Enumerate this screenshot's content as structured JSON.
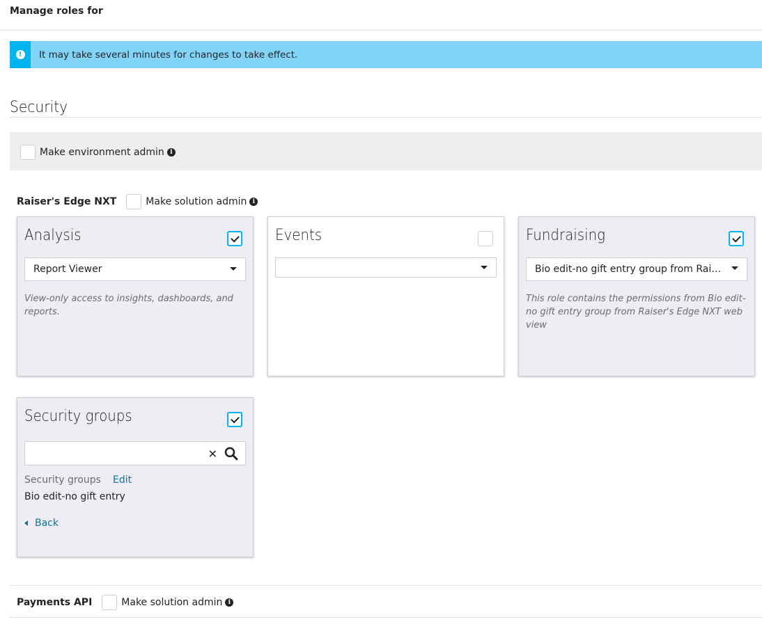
{
  "header": {
    "title": "Manage roles for"
  },
  "alert": {
    "icon": "exclamation-icon",
    "text": "It may take several minutes for changes to take effect.",
    "color": "#81d3f7",
    "accent": "#00b4f1"
  },
  "security": {
    "title": "Security",
    "environment_admin": {
      "label": "Make environment admin",
      "checked": false
    }
  },
  "raisers_edge": {
    "name": "Raiser's Edge NXT",
    "solution_admin": {
      "label": "Make solution admin",
      "checked": false
    },
    "cards": [
      {
        "title": "Analysis",
        "checked": true,
        "selected_role": "Report Viewer",
        "description": "View-only access to insights, dashboards, and reports."
      },
      {
        "title": "Events",
        "checked": false,
        "selected_role": "",
        "description": ""
      },
      {
        "title": "Fundraising",
        "checked": true,
        "selected_role": "Bio edit-no gift entry group from Raiser's Edge NXT web view",
        "description": "This role contains the permissions from Bio edit-no gift entry group from Raiser's Edge NXT web view"
      }
    ],
    "security_groups": {
      "title": "Security groups",
      "checked": true,
      "search_value": "",
      "list_label": "Security groups",
      "edit_label": "Edit",
      "selected_group": "Bio edit-no gift entry",
      "back_label": "Back"
    }
  },
  "payments_api": {
    "name": "Payments API",
    "solution_admin": {
      "label": "Make solution admin",
      "checked": false
    }
  }
}
